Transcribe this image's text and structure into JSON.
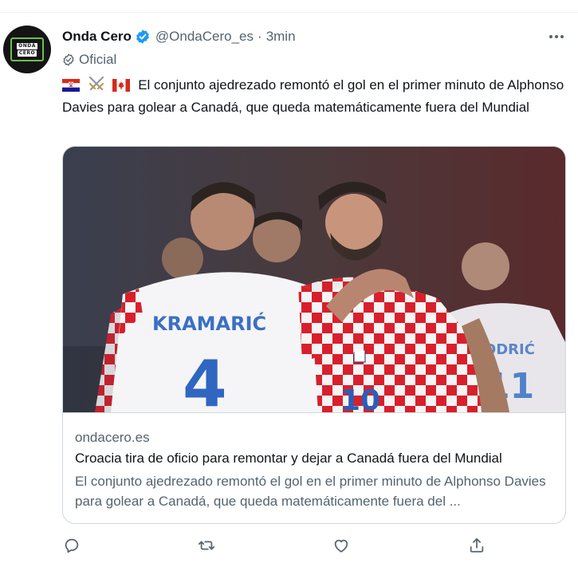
{
  "author": {
    "name": "Onda Cero",
    "handle": "@OndaCero_es",
    "separator": "·",
    "time": "3min",
    "badge_label": "Oficial",
    "avatar_lines": [
      "ONDA",
      "CERO"
    ],
    "verified_color": "#1d9bf0"
  },
  "tweet": {
    "emojis": [
      "croatia-flag",
      "crossed-swords",
      "canada-flag"
    ],
    "text": "El conjunto ajedrezado remontó el gol en el primer minuto de Alphonso Davies para golear a Canadá, que queda matemáticamente fuera del Mundial"
  },
  "card": {
    "image_alt": "Jugadores de Croacia celebrando",
    "image_visible_text": [
      "KRAMARIĆ",
      "MODRIĆ",
      "4",
      "10",
      "11"
    ],
    "domain": "ondacero.es",
    "title": "Croacia tira de oficio para remontar y dejar a Canadá fuera del Mundial",
    "description": "El conjunto ajedrezado remontó el gol en el primer minuto de Alphonso Davies para golear a Canadá, que queda matemáticamente fuera del ..."
  },
  "actions": [
    "reply-icon",
    "retweet-icon",
    "like-icon",
    "share-icon"
  ],
  "colors": {
    "text": "#0f1419",
    "muted": "#536471",
    "border": "#cfd9de",
    "accent": "#1d9bf0"
  }
}
